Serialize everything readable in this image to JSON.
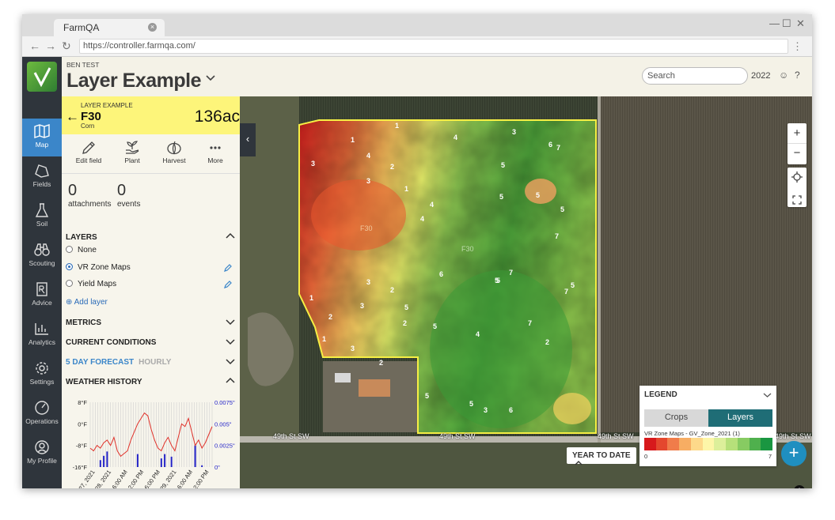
{
  "browser": {
    "tab_title": "FarmQA",
    "tab_close": "×",
    "url": "https://controller.farmqa.com/",
    "window_controls": [
      "—",
      "☐",
      "✕"
    ]
  },
  "nav": {
    "items": [
      {
        "label": "Map",
        "icon": "map-icon"
      },
      {
        "label": "Fields",
        "icon": "fields-icon"
      },
      {
        "label": "Soil",
        "icon": "flask-icon"
      },
      {
        "label": "Scouting",
        "icon": "binoculars-icon"
      },
      {
        "label": "Advice",
        "icon": "prescription-icon"
      },
      {
        "label": "Analytics",
        "icon": "bar-chart-icon"
      },
      {
        "label": "Settings",
        "icon": "gear-icon"
      },
      {
        "label": "Operations",
        "icon": "gauge-icon"
      },
      {
        "label": "My Profile",
        "icon": "user-icon"
      }
    ]
  },
  "header": {
    "project": "BEN TEST",
    "title": "Layer Example",
    "search_placeholder": "Search",
    "year": "2022"
  },
  "field": {
    "label": "LAYER EXAMPLE",
    "name": "F30",
    "crop": "Corn",
    "area": "136ac"
  },
  "actions": [
    {
      "label": "Edit field",
      "icon": "pencil-icon"
    },
    {
      "label": "Plant",
      "icon": "seedling-icon"
    },
    {
      "label": "Harvest",
      "icon": "pumpkin-icon"
    },
    {
      "label": "More",
      "icon": "dots-icon"
    }
  ],
  "counts": {
    "attachments": {
      "value": "0",
      "label": "attachments"
    },
    "events": {
      "value": "0",
      "label": "events"
    }
  },
  "layers": {
    "heading": "LAYERS",
    "options": [
      {
        "label": "None",
        "selected": false
      },
      {
        "label": "VR Zone Maps",
        "selected": true
      },
      {
        "label": "Yield Maps",
        "selected": false
      }
    ],
    "add_label": "Add layer"
  },
  "sections": {
    "metrics": "METRICS",
    "conditions": "CURRENT CONDITIONS",
    "forecast_5day": "5 DAY FORECAST",
    "forecast_hourly": "HOURLY",
    "weather_history": "WEATHER HISTORY"
  },
  "chart_data": {
    "type": "line",
    "title": "",
    "y_left_ticks": [
      "8°F",
      "0°F",
      "-8°F",
      "-16°F"
    ],
    "y_right_ticks": [
      "0.0075\"",
      "0.005\"",
      "0.0025\"",
      "0\""
    ],
    "ylim": [
      -16,
      8
    ],
    "y2lim": [
      0,
      0.0075
    ],
    "x_ticks": [
      "Dec 27, 2021",
      "Dec 28, 2021",
      "6:00 AM",
      "12:00 PM",
      "6:00 PM",
      "Dec 29, 2021",
      "6:00 AM",
      "12:00 PM"
    ],
    "series": [
      {
        "name": "",
        "kind": "line",
        "color": "#e0312a",
        "x": [
          0,
          2,
          4,
          6,
          8,
          10,
          12,
          14,
          16,
          18,
          20,
          22,
          24,
          26,
          28,
          30,
          32,
          34,
          36,
          38,
          40,
          42,
          44,
          46,
          48,
          50,
          52,
          54,
          56,
          58,
          60,
          62,
          64,
          66,
          68,
          70,
          72
        ],
        "values": [
          -9,
          -10,
          -8,
          -9,
          -7,
          -6,
          -8,
          -5,
          -10,
          -12,
          -11,
          -10,
          -6,
          -3,
          0,
          2,
          4,
          3,
          -2,
          -6,
          -9,
          -10,
          -7,
          -5,
          -8,
          -10,
          -5,
          0,
          -1,
          2,
          -3,
          -8,
          -6,
          -9,
          -7,
          -4,
          -1
        ]
      },
      {
        "name": "",
        "kind": "bar",
        "color": "#2424c8",
        "x": [
          6,
          8,
          10,
          28,
          42,
          44,
          48,
          62,
          66
        ],
        "values": [
          0.0008,
          0.0013,
          0.0018,
          0.0015,
          0.001,
          0.0015,
          0.0012,
          0.0025,
          0.0002
        ]
      }
    ]
  },
  "map": {
    "field_label": "F30",
    "road_labels": [
      "49th St SW",
      "49th St SW",
      "49th St SW",
      "49th St SW"
    ],
    "zoom_in": "+",
    "zoom_out": "−",
    "year_to_date": "YEAR TO DATE"
  },
  "legend": {
    "heading": "LEGEND",
    "tabs": [
      "Crops",
      "Layers"
    ],
    "active_tab": "Layers",
    "layer_name": "VR Zone Maps - GV_Zone_2021 (1)",
    "min": "0",
    "max": "7",
    "colors": [
      "#d7191c",
      "#e4472e",
      "#f07c4a",
      "#f7ad63",
      "#fdd98a",
      "#fdf6a8",
      "#dcef9a",
      "#b6e07a",
      "#87cb62",
      "#4fb04d",
      "#1a9641"
    ]
  },
  "zone_labels": [
    {
      "t": "1"
    },
    {
      "t": "4"
    },
    {
      "t": "3"
    },
    {
      "t": "1"
    },
    {
      "t": "3"
    },
    {
      "t": "4"
    },
    {
      "t": "2"
    },
    {
      "t": "3"
    },
    {
      "t": "1"
    },
    {
      "t": "5"
    },
    {
      "t": "5"
    },
    {
      "t": "6"
    },
    {
      "t": "7"
    },
    {
      "t": "5"
    },
    {
      "t": "5"
    },
    {
      "t": "4"
    },
    {
      "t": "4"
    },
    {
      "t": "7"
    },
    {
      "t": "7"
    },
    {
      "t": "5"
    },
    {
      "t": "1"
    },
    {
      "t": "2"
    },
    {
      "t": "2"
    },
    {
      "t": "3"
    },
    {
      "t": "6"
    },
    {
      "t": "5"
    },
    {
      "t": "2"
    },
    {
      "t": "5"
    },
    {
      "t": "5"
    },
    {
      "t": "3"
    },
    {
      "t": "1"
    },
    {
      "t": "3"
    },
    {
      "t": "2"
    },
    {
      "t": "5"
    },
    {
      "t": "3"
    },
    {
      "t": "7"
    },
    {
      "t": "6"
    },
    {
      "t": "5"
    },
    {
      "t": "7"
    },
    {
      "t": "5"
    },
    {
      "t": "4"
    },
    {
      "t": "2"
    }
  ]
}
